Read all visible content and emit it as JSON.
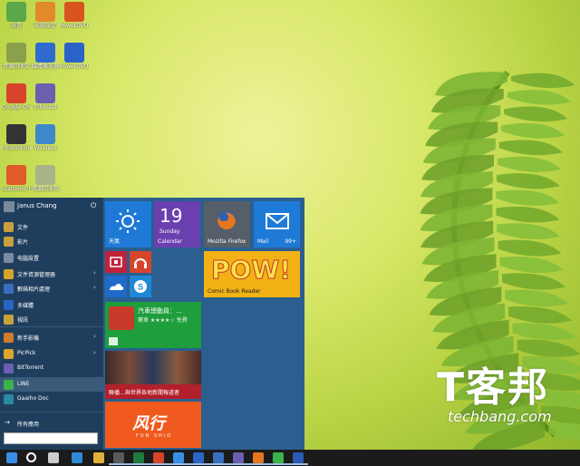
{
  "desktop_icons": [
    {
      "label": "設置",
      "color": "#5aa84a",
      "col": 0,
      "row": 0
    },
    {
      "label": "電腦設定",
      "color": "#e08a2a",
      "col": 1,
      "row": 0
    },
    {
      "label": "PowerDVD Deluxe",
      "color": "#d9551e",
      "col": 2,
      "row": 0
    },
    {
      "label": "資源回收筒",
      "color": "#8aa04a",
      "col": 0,
      "row": 1
    },
    {
      "label": "媒體播放器",
      "color": "#2f6ad0",
      "col": 1,
      "row": 1
    },
    {
      "label": "PowerDVD Converter",
      "color": "#2b62c8",
      "col": 2,
      "row": 1
    },
    {
      "label": "Google Chrome",
      "color": "#d8432b",
      "col": 0,
      "row": 2
    },
    {
      "label": "Ethereal",
      "color": "#6b5fb0",
      "col": 1,
      "row": 2
    },
    {
      "label": "PhotoShop 9",
      "color": "#333333",
      "col": 0,
      "row": 3
    },
    {
      "label": "Wireless",
      "color": "#3c88c9",
      "col": 1,
      "row": 3
    },
    {
      "label": "Starpoint Presentation",
      "color": "#e05a2a",
      "col": 0,
      "row": 4
    },
    {
      "label": "資源回收筒",
      "color": "#a8b488",
      "col": 1,
      "row": 4
    }
  ],
  "start_menu": {
    "user_name": "Janus Chang",
    "power_icon": "power-icon",
    "all_apps": "所有應用",
    "items": [
      {
        "label": "文件",
        "icon": "documents-icon",
        "color": "#c9a13a",
        "arrow": ""
      },
      {
        "label": "影片",
        "icon": "videos-icon",
        "color": "#c9a13a",
        "arrow": ""
      },
      {
        "label": "电腦設置",
        "icon": "settings-icon",
        "color": "#7a8aa0",
        "arrow": ""
      },
      {
        "label": "文件資源管理器",
        "icon": "explorer-icon",
        "color": "#d4a52a",
        "arrow": "›"
      },
      {
        "label": "數碼相片處理",
        "icon": "photo-icon",
        "color": "#3a6fc0",
        "arrow": "›"
      },
      {
        "label": "多媒體",
        "icon": "media-icon",
        "color": "#2a65c5",
        "arrow": ""
      },
      {
        "label": "視訊",
        "icon": "video-icon",
        "color": "#c9a13a",
        "arrow": ""
      },
      {
        "label": "新手影機",
        "icon": "camera-icon",
        "color": "#d07a2a",
        "arrow": "›"
      },
      {
        "label": "PicPick",
        "icon": "picpick-icon",
        "color": "#d9a52a",
        "arrow": "›"
      },
      {
        "label": "BitTorrent",
        "icon": "bittorrent-icon",
        "color": "#6b5fb0",
        "arrow": ""
      },
      {
        "label": "LINE",
        "icon": "line-icon",
        "color": "#3cb34a",
        "arrow": ""
      },
      {
        "label": "Gaaiho Doc",
        "icon": "gaaiho-icon",
        "color": "#2a88a0",
        "arrow": ""
      }
    ]
  },
  "tiles": {
    "weather": {
      "label": "天氣",
      "color": "#1e7ad6"
    },
    "calendar": {
      "day": "19",
      "weekday": "Sunday",
      "label": "Calendar",
      "color": "#6a3fb0"
    },
    "firefox": {
      "label": "Mozilla Firefox",
      "color": "#555e69"
    },
    "mail": {
      "label": "Mail",
      "count": "99+",
      "color": "#1e7ad6"
    },
    "small1": {
      "color": "#c4213a",
      "icon": "video-icon"
    },
    "small2": {
      "color": "#d6452a",
      "icon": "music-icon"
    },
    "small3": {
      "color": "#1e6bc9",
      "icon": "onedrive-icon"
    },
    "small4": {
      "color": "#1e88d6",
      "icon": "skype-icon"
    },
    "pow": {
      "text": "POW!",
      "label": "Comic Book Reader",
      "color": "#f2b215"
    },
    "store": {
      "title": "汽車總動員：...",
      "sub": "賽車 ★★★★☆ 免費",
      "color": "#1e9e3c"
    },
    "news": {
      "label": "聯播…與世界各地新聞報道者",
      "color": "#b31f2a"
    },
    "fengxing": {
      "brand": "风行",
      "sub": "FUN SHIO",
      "color": "#f05a1e"
    }
  },
  "taskbar": {
    "items": [
      {
        "icon": "windows-start-icon",
        "color": "#3a8ee6"
      },
      {
        "icon": "search-icon",
        "color": "#ffffff"
      },
      {
        "icon": "task-view-icon",
        "color": "#cccccc"
      },
      {
        "icon": "ie-icon",
        "color": "#2e8ad6"
      },
      {
        "icon": "file-explorer-icon",
        "color": "#e0b23a"
      },
      {
        "icon": "store-icon",
        "color": "#5a5a5a"
      },
      {
        "icon": "excel-icon",
        "color": "#1e7b3c"
      },
      {
        "icon": "chrome-icon",
        "color": "#d8432b"
      },
      {
        "icon": "remote-icon",
        "color": "#3a8ee6"
      },
      {
        "icon": "media-icon",
        "color": "#2a65c5"
      },
      {
        "icon": "photo-icon",
        "color": "#3a6fc0"
      },
      {
        "icon": "ethereal-icon",
        "color": "#6b5fb0"
      },
      {
        "icon": "firefox-icon",
        "color": "#e5771e"
      },
      {
        "icon": "line-icon",
        "color": "#3cb34a"
      },
      {
        "icon": "word-icon",
        "color": "#2a5cb5"
      }
    ]
  },
  "watermark": {
    "big": "T客邦",
    "url": "techbang.com"
  }
}
